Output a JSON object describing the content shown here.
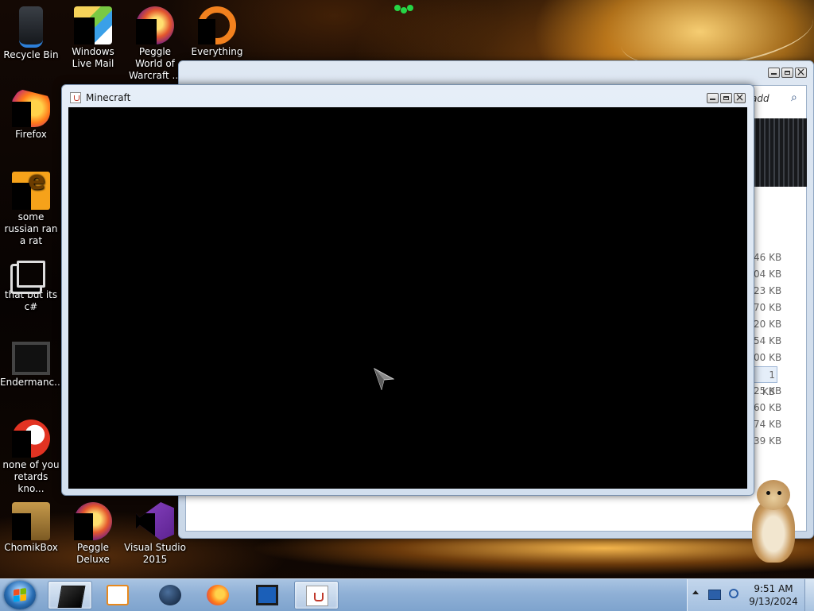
{
  "desktop": {
    "icons": [
      {
        "label": "Recycle Bin",
        "icon": "recycle-bin-icon"
      },
      {
        "label": "Windows Live Mail",
        "icon": "mail-icon"
      },
      {
        "label": "Peggle World of Warcraft ...",
        "icon": "peggle-icon"
      },
      {
        "label": "Everything",
        "icon": "everything-search-icon"
      },
      {
        "label": "Firefox",
        "icon": "firefox-icon"
      },
      {
        "label": "some russian ran a rat",
        "icon": "file-e-icon"
      },
      {
        "label": "that but its c#",
        "icon": "copy-files-icon"
      },
      {
        "label": "Endermanc...",
        "icon": "monitor-app-icon"
      },
      {
        "label": "none of you retards kno...",
        "icon": "red-circle-app-icon"
      },
      {
        "label": "ChomikBox",
        "icon": "chomikbox-icon"
      },
      {
        "label": "Peggle Deluxe",
        "icon": "peggle-deluxe-icon"
      },
      {
        "label": "Visual Studio 2015",
        "icon": "visual-studio-icon"
      }
    ]
  },
  "explorer": {
    "address_fragment": "add",
    "file_sizes": [
      "46 KB",
      "04 KB",
      "23 KB",
      "70 KB",
      "20 KB",
      "54 KB",
      "00 KB",
      "1 KB",
      "25 KB",
      "60 KB",
      "74 KB",
      "39 KB"
    ],
    "selected_index": 7
  },
  "minecraft_window": {
    "title": "Minecraft"
  },
  "taskbar": {
    "items": [
      {
        "name": "taskbar-item-monitor-app",
        "icon": "black-box-icon",
        "active": true
      },
      {
        "name": "taskbar-item-media-player",
        "icon": "media-player-icon",
        "active": false
      },
      {
        "name": "taskbar-item-steam",
        "icon": "globe-icon",
        "active": false
      },
      {
        "name": "taskbar-item-firefox",
        "icon": "firefox-icon",
        "active": false
      },
      {
        "name": "taskbar-item-explorer",
        "icon": "window-icon",
        "active": false
      },
      {
        "name": "taskbar-item-java",
        "icon": "java-icon",
        "active": true
      }
    ],
    "clock_time": "9:51 AM",
    "clock_date": "9/13/2024"
  },
  "colors": {
    "taskbar": "#8fb0d6",
    "wallpaper_glow": "#ffb74a",
    "accent_blue": "#2b5fa8"
  }
}
